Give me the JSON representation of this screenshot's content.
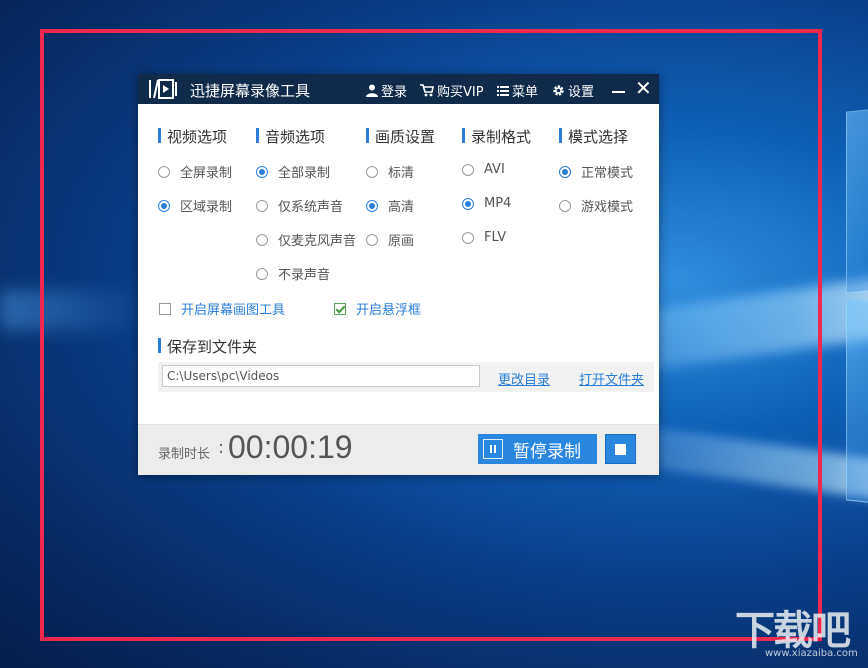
{
  "app": {
    "title": "迅捷屏幕录像工具",
    "login": "登录",
    "vip": "购买VIP",
    "menu": "菜单",
    "settings": "设置"
  },
  "sections": {
    "video": {
      "heading": "视频选项",
      "options": [
        {
          "label": "全屏录制",
          "selected": false
        },
        {
          "label": "区域录制",
          "selected": true
        }
      ]
    },
    "audio": {
      "heading": "音频选项",
      "options": [
        {
          "label": "全部录制",
          "selected": true
        },
        {
          "label": "仅系统声音",
          "selected": false
        },
        {
          "label": "仅麦克风声音",
          "selected": false
        },
        {
          "label": "不录声音",
          "selected": false
        }
      ]
    },
    "quality": {
      "heading": "画质设置",
      "options": [
        {
          "label": "标清",
          "selected": false
        },
        {
          "label": "高清",
          "selected": true
        },
        {
          "label": "原画",
          "selected": false
        }
      ]
    },
    "format": {
      "heading": "录制格式",
      "options": [
        {
          "label": "AVI",
          "selected": false
        },
        {
          "label": "MP4",
          "selected": true
        },
        {
          "label": "FLV",
          "selected": false
        }
      ]
    },
    "mode": {
      "heading": "模式选择",
      "options": [
        {
          "label": "正常模式",
          "selected": true
        },
        {
          "label": "游戏模式",
          "selected": false
        }
      ]
    }
  },
  "checks": {
    "draw_tool": {
      "label": "开启屏幕画图工具",
      "checked": false
    },
    "float_window": {
      "label": "开启悬浮框",
      "checked": true
    }
  },
  "folder": {
    "heading": "保存到文件夹",
    "path": "C:\\Users\\pc\\Videos",
    "change_link": "更改目录",
    "open_link": "打开文件夹"
  },
  "recording": {
    "duration_label": "录制时长",
    "duration_colon": ":",
    "duration_value": "00:00:19",
    "pause_label": "暂停录制"
  },
  "watermark": {
    "text": "下载吧",
    "url": "www.xiazaiba.com"
  },
  "colors": {
    "accent": "#2a7ed8",
    "titlebar": "#102a4c",
    "recording_frame": "#f0284e"
  }
}
